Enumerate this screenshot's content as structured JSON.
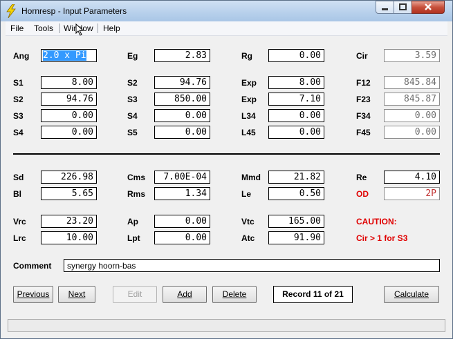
{
  "window": {
    "title": "Hornresp - Input Parameters"
  },
  "menu": [
    "File",
    "Tools",
    "Window",
    "Help"
  ],
  "fields": {
    "ang": {
      "label": "Ang",
      "value": "2.0 x Pi"
    },
    "eg": {
      "label": "Eg",
      "value": "2.83"
    },
    "rg": {
      "label": "Rg",
      "value": "0.00"
    },
    "cir": {
      "label": "Cir",
      "value": "3.59"
    },
    "s1": {
      "label": "S1",
      "value": "8.00"
    },
    "s2b": {
      "label": "S2",
      "value": "94.76"
    },
    "exp1": {
      "label": "Exp",
      "value": "8.00"
    },
    "f12": {
      "label": "F12",
      "value": "845.84"
    },
    "s2": {
      "label": "S2",
      "value": "94.76"
    },
    "s3b": {
      "label": "S3",
      "value": "850.00"
    },
    "exp2": {
      "label": "Exp",
      "value": "7.10"
    },
    "f23": {
      "label": "F23",
      "value": "845.87"
    },
    "s3": {
      "label": "S3",
      "value": "0.00"
    },
    "s4b": {
      "label": "S4",
      "value": "0.00"
    },
    "l34": {
      "label": "L34",
      "value": "0.00"
    },
    "f34": {
      "label": "F34",
      "value": "0.00"
    },
    "s4": {
      "label": "S4",
      "value": "0.00"
    },
    "s5": {
      "label": "S5",
      "value": "0.00"
    },
    "l45": {
      "label": "L45",
      "value": "0.00"
    },
    "f45": {
      "label": "F45",
      "value": "0.00"
    },
    "sd": {
      "label": "Sd",
      "value": "226.98"
    },
    "cms": {
      "label": "Cms",
      "value": "7.00E-04"
    },
    "mmd": {
      "label": "Mmd",
      "value": "21.82"
    },
    "re": {
      "label": "Re",
      "value": "4.10"
    },
    "bl": {
      "label": "Bl",
      "value": "5.65"
    },
    "rms": {
      "label": "Rms",
      "value": "1.34"
    },
    "le": {
      "label": "Le",
      "value": "0.50"
    },
    "od": {
      "label": "OD",
      "value": "2P"
    },
    "vrc": {
      "label": "Vrc",
      "value": "23.20"
    },
    "ap": {
      "label": "Ap",
      "value": "0.00"
    },
    "vtc": {
      "label": "Vtc",
      "value": "165.00"
    },
    "lrc": {
      "label": "Lrc",
      "value": "10.00"
    },
    "lpt": {
      "label": "Lpt",
      "value": "0.00"
    },
    "atc": {
      "label": "Atc",
      "value": "91.90"
    }
  },
  "caution": {
    "title": "CAUTION:",
    "message": "Cir > 1 for S3"
  },
  "comment": {
    "label": "Comment",
    "value": "synergy hoorn-bas"
  },
  "buttons": {
    "previous": "Previous",
    "next": "Next",
    "edit": "Edit",
    "add": "Add",
    "delete": "Delete",
    "calculate": "Calculate"
  },
  "record": "Record 11 of 21",
  "colors": {
    "caution": "#e00000",
    "selection": "#3399ff"
  }
}
